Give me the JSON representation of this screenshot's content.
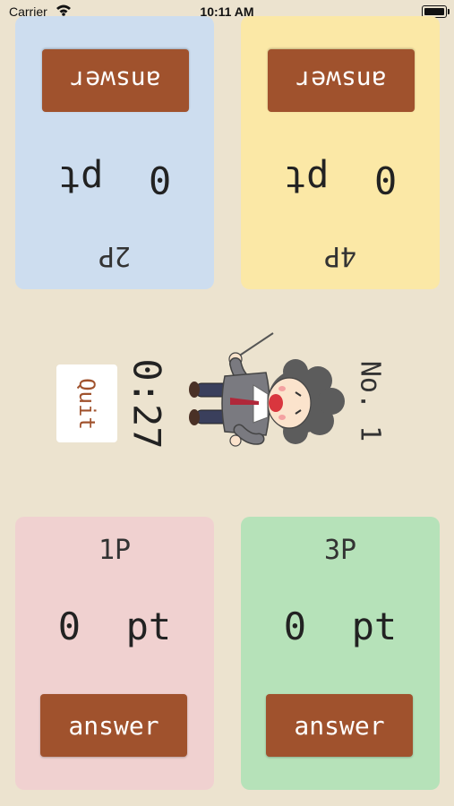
{
  "status_bar": {
    "carrier": "Carrier",
    "time": "10:11 AM"
  },
  "players": {
    "p1": {
      "label": "1P",
      "score": "0  pt",
      "answer_label": "answer",
      "color": "#f0d1d0"
    },
    "p2": {
      "label": "2P",
      "score": "0  pt",
      "answer_label": "answer",
      "color": "#cdddef"
    },
    "p3": {
      "label": "3P",
      "score": "0  pt",
      "answer_label": "answer",
      "color": "#b6e2b9"
    },
    "p4": {
      "label": "4P",
      "score": "0  pt",
      "answer_label": "answer",
      "color": "#fbe8a6"
    }
  },
  "center": {
    "quit_label": "Quit",
    "timer": "0:27",
    "round": "No. 1",
    "character_icon": "conductor-character-icon"
  },
  "colors": {
    "background": "#ece3cf",
    "answer_button": "#a0522d",
    "quit_text": "#a0522d"
  }
}
